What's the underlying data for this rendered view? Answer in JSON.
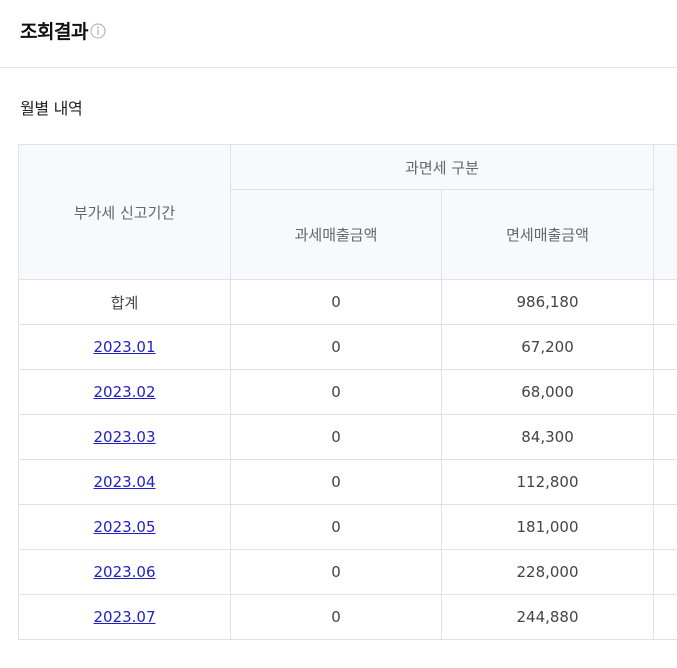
{
  "header": {
    "title": "조회결과"
  },
  "section": {
    "subtitle": "월별 내역"
  },
  "table": {
    "group_header": "과면세 구분",
    "columns": [
      "부가세 신고기간",
      "과세매출금액",
      "면세매출금액"
    ],
    "total_row": {
      "label": "합계",
      "taxable": "0",
      "exempt": "986,180"
    },
    "rows": [
      {
        "period": "2023.01",
        "taxable": "0",
        "exempt": "67,200"
      },
      {
        "period": "2023.02",
        "taxable": "0",
        "exempt": "68,000"
      },
      {
        "period": "2023.03",
        "taxable": "0",
        "exempt": "84,300"
      },
      {
        "period": "2023.04",
        "taxable": "0",
        "exempt": "112,800"
      },
      {
        "period": "2023.05",
        "taxable": "0",
        "exempt": "181,000"
      },
      {
        "period": "2023.06",
        "taxable": "0",
        "exempt": "228,000"
      },
      {
        "period": "2023.07",
        "taxable": "0",
        "exempt": "244,880"
      }
    ]
  },
  "colors": {
    "header_bg": "#f8f9fc",
    "border": "#e0e2e8",
    "link": "#1f1fc8"
  },
  "icons": {
    "title_icon": "info-icon"
  }
}
